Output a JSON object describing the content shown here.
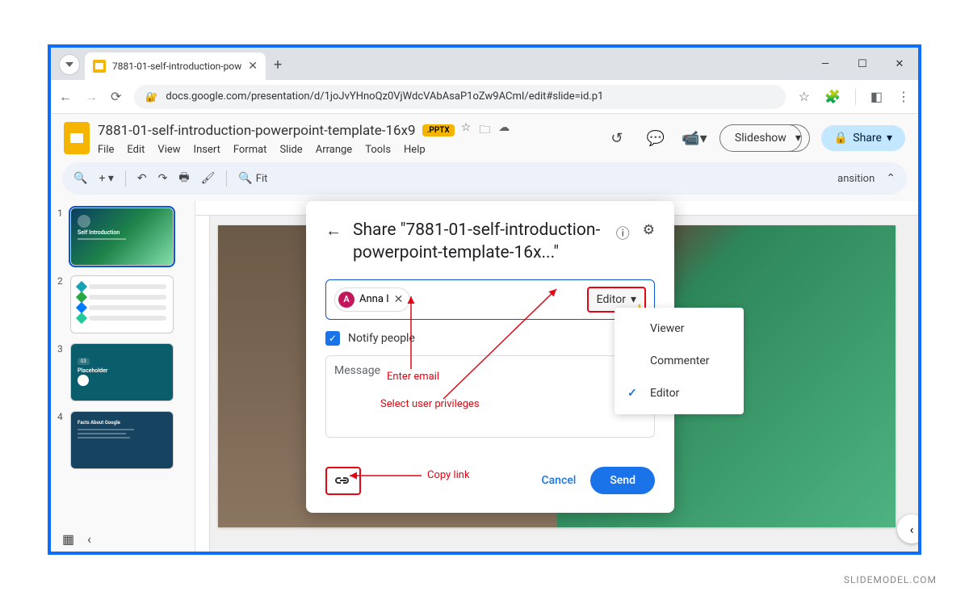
{
  "browser": {
    "tab_title": "7881-01-self-introduction-pow",
    "url": "docs.google.com/presentation/d/1joJvYHnoQz0VjWdcVAbAsaP1oZw9ACmI/edit#slide=id.p1"
  },
  "app": {
    "doc_title": "7881-01-self-introduction-powerpoint-template-16x9",
    "badge": ".PPTX",
    "menu": {
      "file": "File",
      "edit": "Edit",
      "view": "View",
      "insert": "Insert",
      "format": "Format",
      "slide": "Slide",
      "arrange": "Arrange",
      "tools": "Tools",
      "help": "Help"
    },
    "slideshow": "Slideshow",
    "share": "Share"
  },
  "toolbar": {
    "fit": "Fit",
    "transition": "ansition"
  },
  "slidepanel": {
    "n1": "1",
    "n2": "2",
    "n3": "3",
    "n4": "4",
    "t1_title": "Self Introduction",
    "t3_title": "Placeholder",
    "t4_title": "Facts About Google"
  },
  "dialog": {
    "title": "Share \"7881-01-self-introduction-powerpoint-template-16x...\"",
    "chip_initial": "A",
    "chip_name": "Anna I",
    "role_label": "Editor",
    "notify": "Notify people",
    "message_placeholder": "Message",
    "cancel": "Cancel",
    "send": "Send"
  },
  "dropdown": {
    "viewer": "Viewer",
    "commenter": "Commenter",
    "editor": "Editor"
  },
  "annotations": {
    "enter_email": "Enter email",
    "select_priv": "Select user privileges",
    "copy_link": "Copy link"
  },
  "watermark": "SLIDEMODEL.COM"
}
